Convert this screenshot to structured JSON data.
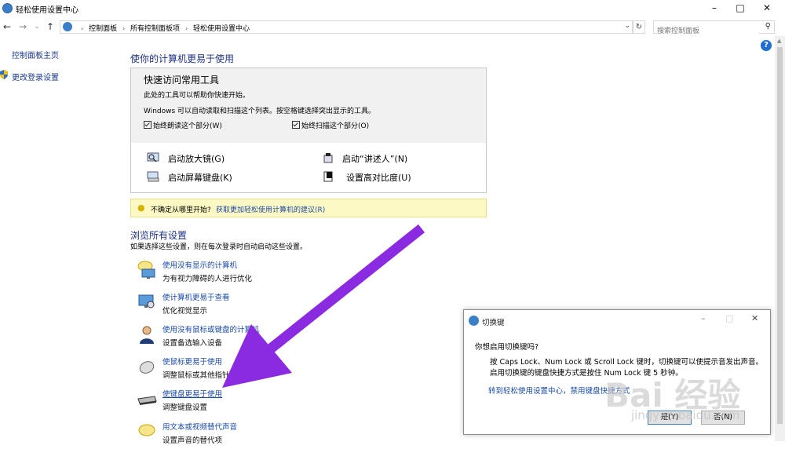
{
  "window": {
    "title": "轻松使用设置中心"
  },
  "address": {
    "crumbs": [
      "控制面板",
      "所有控制面板项",
      "轻松使用设置中心"
    ],
    "search_placeholder": "搜索控制面板"
  },
  "sidebar": {
    "items": [
      {
        "label": "控制面板主页"
      },
      {
        "label": "更改登录设置"
      }
    ]
  },
  "main": {
    "heading": "使你的计算机更易于使用",
    "quick": {
      "title": "快速访问常用工具",
      "line1": "此处的工具可以帮助你快速开始。",
      "line2": "Windows 可以自动读取和扫描这个列表。按空格键选择突出显示的工具。",
      "check_read": "始终朗读这个部分(W)",
      "check_scan": "始终扫描这个部分(O)",
      "tools": [
        {
          "label": "启动放大镜(G)"
        },
        {
          "label": "启动“讲述人”(N)"
        },
        {
          "label": "启动屏幕键盘(K)"
        },
        {
          "label": "设置高对比度(U)"
        }
      ]
    },
    "tip": {
      "text": "不确定从哪里开始?",
      "link": "获取更加轻松使用计算机的建议(R)"
    },
    "browse": {
      "heading": "浏览所有设置",
      "subtitle": "如果选择这些设置，则在每次登录时自动启动这些设置。",
      "items": [
        {
          "link": "使用没有显示的计算机",
          "desc": "为有视力障碍的人进行优化"
        },
        {
          "link": "使计算机更易于查看",
          "desc": "优化视觉显示"
        },
        {
          "link": "使用没有鼠标或键盘的计算机",
          "desc": "设置备选输入设备"
        },
        {
          "link": "使鼠标更易于使用",
          "desc": "调整鼠标或其他指针设备的设置"
        },
        {
          "link": "使键盘更易于使用",
          "desc": "调整键盘设置"
        },
        {
          "link": "用文本或视频替代声音",
          "desc": "设置声音的替代项"
        }
      ]
    }
  },
  "dialog": {
    "title": "切换键",
    "question": "你想启用切换键吗?",
    "body1": "按 Caps Lock、Num Lock 或 Scroll Lock 键时，切换键可以使提示音发出声音。",
    "body2": "启用切换键的键盘快捷方式是按住 Num Lock 键 5 秒钟。",
    "link": "转到轻松使用设置中心，禁用键盘快捷方式",
    "yes": "是(Y)",
    "no": "否(N)"
  },
  "watermark": {
    "brand": "Bai 经验",
    "url": "jingyan.baidu.com"
  },
  "colors": {
    "link": "#1a4aa8",
    "heading": "#1e3287",
    "arrow": "#8a2be2",
    "tip_bg": "#fcf9c4"
  }
}
